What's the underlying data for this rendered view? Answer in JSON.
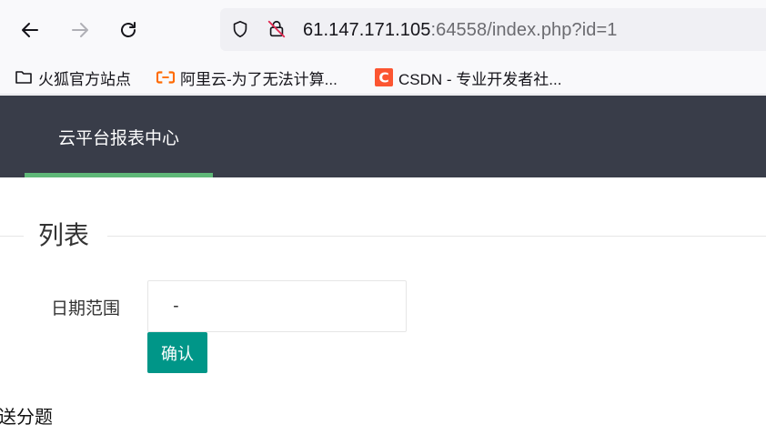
{
  "browser": {
    "url_host": "61.147.171.105",
    "url_rest": ":64558/index.php?id=1",
    "bookmarks": [
      {
        "label": "火狐官方站点",
        "icon": "folder-icon"
      },
      {
        "label": "阿里云-为了无法计算...",
        "icon": "aliyun-icon",
        "color": "#ff6a00"
      },
      {
        "label": "CSDN - 专业开发者社...",
        "icon": "csdn-icon",
        "color": "#fc5531"
      }
    ]
  },
  "header": {
    "nav_item": "云平台报表中心",
    "bg_color": "#393d49",
    "active_color": "#5fb878"
  },
  "section": {
    "legend": "列表"
  },
  "form": {
    "date_label": "日期范围",
    "date_value": " - ",
    "confirm_label": "确认",
    "button_color": "#009688"
  },
  "footer_text": "送分题"
}
